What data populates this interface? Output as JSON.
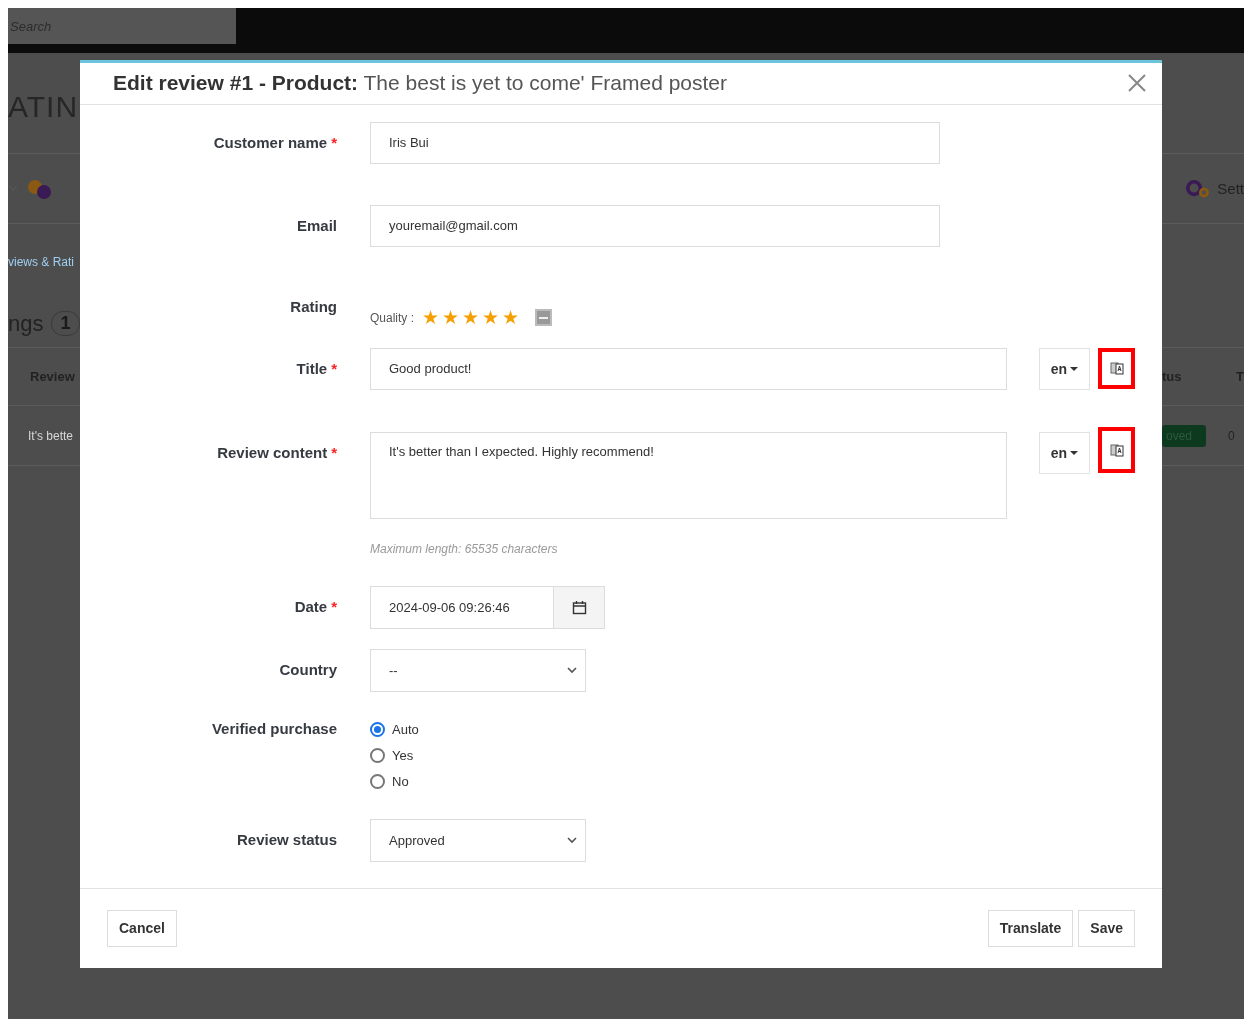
{
  "background": {
    "search": {
      "placeholder": "Search"
    },
    "left": {
      "heading": "ATIN",
      "tab": "views & Rati",
      "section_title": "ngs",
      "count": "1",
      "column_1": "Review",
      "cell_1": "It's bette"
    },
    "right": {
      "settings": "Sett",
      "column_1": "tus",
      "column_2": "T",
      "status_badge": "oved",
      "cell_2": "0"
    }
  },
  "modal": {
    "title": "**Edit review #1 - Product:** The best is yet to come' Framed poster",
    "fields": [
      {
        "kind": "text",
        "label": "Customer name",
        "required_mark": "*",
        "value": "Iris Bui"
      },
      {
        "kind": "text",
        "label": "Email",
        "value": "youremail@gmail.com"
      },
      {
        "kind": "rating",
        "label": "Rating",
        "criterion": "Quality :",
        "stars": 5
      },
      {
        "kind": "translatable",
        "label": "Title",
        "required_mark": "*",
        "value": "Good product!",
        "language": "en",
        "highlighted": true
      },
      {
        "kind": "textarea",
        "label": "Review content",
        "required_mark": "*",
        "value": "It's better than I expected. Highly recommend!",
        "language": "en",
        "highlighted": true,
        "hint": "Maximum length: 65535 characters"
      },
      {
        "kind": "date",
        "label": "Date",
        "required_mark": "*",
        "value": "2024-09-06 09:26:46"
      },
      {
        "kind": "select",
        "label": "Country",
        "value": "--"
      },
      {
        "kind": "radio",
        "label": "Verified purchase",
        "options": [
          {
            "label": "Auto",
            "selected": true
          },
          {
            "label": "Yes",
            "selected": false
          },
          {
            "label": "No",
            "selected": false
          }
        ]
      },
      {
        "kind": "select",
        "label": "Review status",
        "value": "Approved"
      }
    ],
    "footer": {
      "cancel": "Cancel",
      "translate": "Translate",
      "save": "Save"
    }
  }
}
